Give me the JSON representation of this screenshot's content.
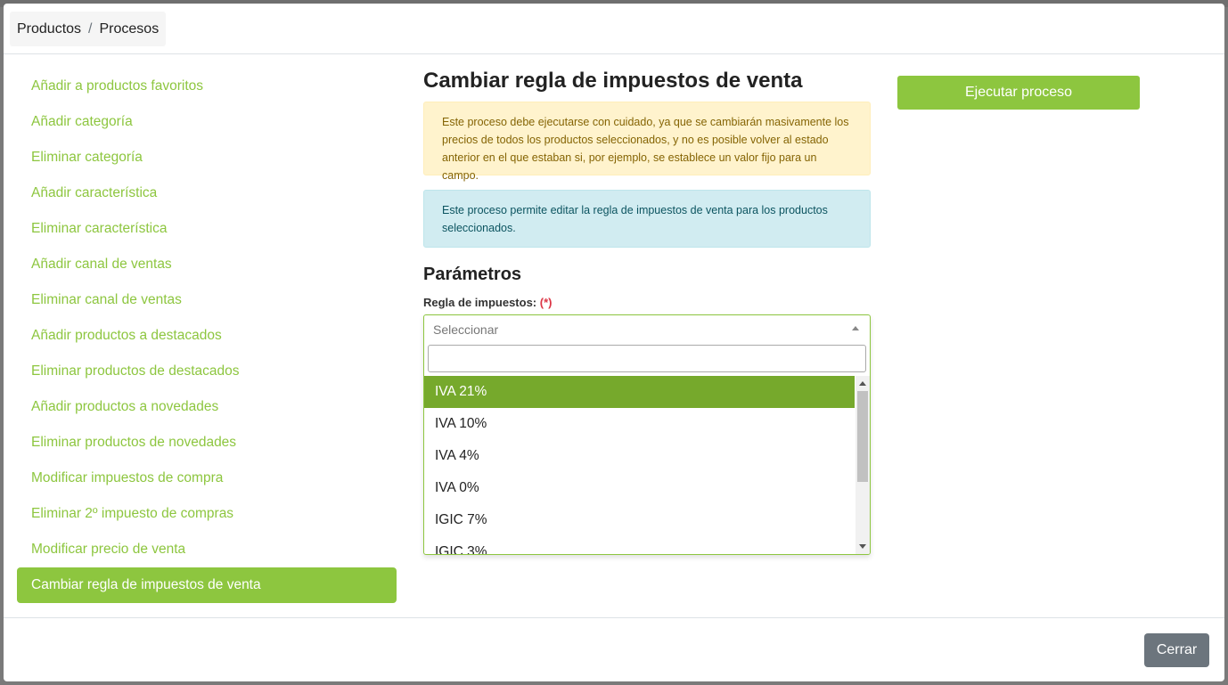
{
  "breadcrumb": {
    "items": [
      "Productos",
      "Procesos"
    ],
    "separator": "/"
  },
  "sidebar": {
    "items": [
      {
        "label": "Añadir a productos favoritos"
      },
      {
        "label": "Añadir categoría"
      },
      {
        "label": "Eliminar categoría"
      },
      {
        "label": "Añadir característica"
      },
      {
        "label": "Eliminar característica"
      },
      {
        "label": "Añadir canal de ventas"
      },
      {
        "label": "Eliminar canal de ventas"
      },
      {
        "label": "Añadir productos a destacados"
      },
      {
        "label": "Eliminar productos de destacados"
      },
      {
        "label": "Añadir productos a novedades"
      },
      {
        "label": "Eliminar productos de novedades"
      },
      {
        "label": "Modificar impuestos de compra"
      },
      {
        "label": "Eliminar 2º impuesto de compras"
      },
      {
        "label": "Modificar precio de venta"
      },
      {
        "label": "Cambiar regla de impuestos de venta"
      }
    ],
    "active_index": 14
  },
  "main": {
    "title": "Cambiar regla de impuestos de venta",
    "warning": "Este proceso debe ejecutarse con cuidado, ya que se cambiarán masivamente los precios de todos los productos seleccionados, y no es posible volver al estado anterior en el que estaban si, por ejemplo, se establece un valor fijo para un campo.",
    "info": "Este proceso permite editar la regla de impuestos de venta para los productos seleccionados.",
    "params_title": "Parámetros",
    "field_label": "Regla de impuestos:",
    "required_mark": "(*)",
    "select": {
      "placeholder": "Seleccionar",
      "search_value": "",
      "options": [
        "IVA 21%",
        "IVA 10%",
        "IVA 4%",
        "IVA 0%",
        "IGIC 7%",
        "IGIC 3%"
      ],
      "highlighted": "IVA 21%"
    }
  },
  "actions": {
    "run_label": "Ejecutar proceso",
    "close_label": "Cerrar"
  },
  "colors": {
    "accent": "#8dc63f",
    "highlight": "#76a92c",
    "warning_bg": "#fff3cd",
    "info_bg": "#d1ecf1",
    "close_bg": "#6c757d"
  }
}
